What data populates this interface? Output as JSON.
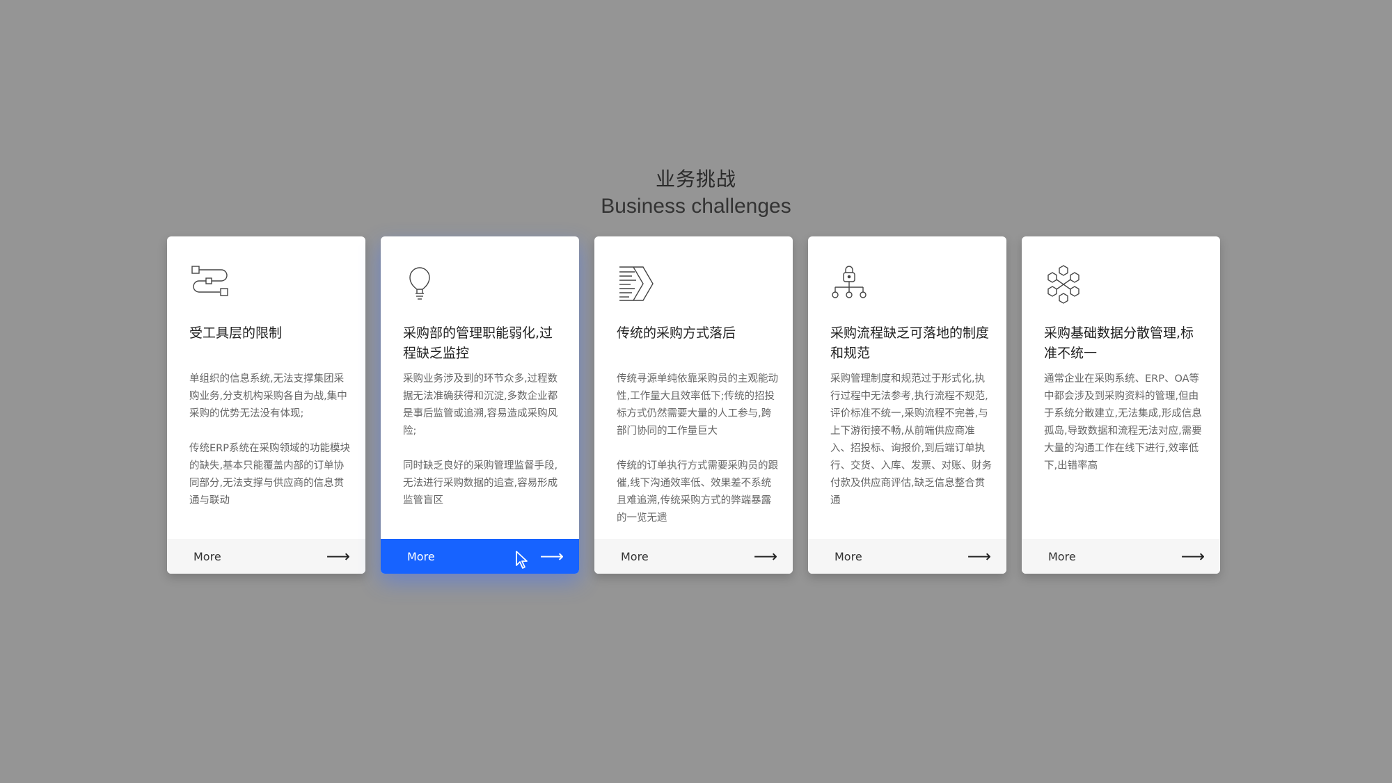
{
  "heading": {
    "zh": "业务挑战",
    "en": "Business challenges"
  },
  "more_label": "More",
  "arrow_glyph": "⟶",
  "accent_color": "#1763ff",
  "cards": [
    {
      "icon": "flow-boxes-icon",
      "title": "受工具层的限制",
      "paragraphs": [
        "单组织的信息系统,无法支撑集团采购业务,分支机构采购各自为战,集中采购的优势无法没有体现;",
        "传统ERP系统在采购领域的功能模块的缺失,基本只能覆盖内部的订单协同部分,无法支撑与供应商的信息贯通与联动"
      ]
    },
    {
      "icon": "lightbulb-icon",
      "title": "采购部的管理职能弱化,过程缺乏监控",
      "paragraphs": [
        "采购业务涉及到的环节众多,过程数据无法准确获得和沉淀,多数企业都是事后监管或追溯,容易造成采购风险;",
        "同时缺乏良好的采购管理监督手段,无法进行采购数据的追查,容易形成监管盲区"
      ]
    },
    {
      "icon": "forward-arrow-icon",
      "title": "传统的采购方式落后",
      "paragraphs": [
        "传统寻源单纯依靠采购员的主观能动性,工作量大且效率低下;传统的招投标方式仍然需要大量的人工参与,跨部门协同的工作量巨大",
        "传统的订单执行方式需要采购员的跟催,线下沟通效率低、效果差不系统且难追溯,传统采购方式的弊端暴露的一览无遗"
      ]
    },
    {
      "icon": "lock-hierarchy-icon",
      "title": "采购流程缺乏可落地的制度和规范",
      "paragraphs": [
        "采购管理制度和规范过于形式化,执行过程中无法参考,执行流程不规范,评价标准不统一,采购流程不完善,与上下游衔接不畅,从前端供应商准入、招投标、询报价,到后端订单执行、交货、入库、发票、对账、财务付款及供应商评估,缺乏信息整合贯通"
      ]
    },
    {
      "icon": "hexagon-network-icon",
      "title": "采购基础数据分散管理,标准不统一",
      "paragraphs": [
        "通常企业在采购系统、ERP、OA等中都会涉及到采购资料的管理,但由于系统分散建立,无法集成,形成信息孤岛,导致数据和流程无法对应,需要大量的沟通工作在线下进行,效率低下,出错率高"
      ]
    }
  ]
}
